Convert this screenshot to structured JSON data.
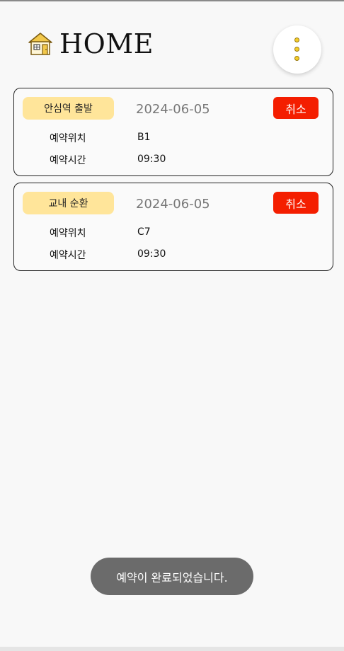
{
  "header": {
    "title": "HOME",
    "home_icon": "house-icon",
    "menu_icon": "more-vertical-icon"
  },
  "reservations": [
    {
      "route": "안심역 출발",
      "date": "2024-06-05",
      "cancel_label": "취소",
      "location_label": "예약위치",
      "location": "B1",
      "time_label": "예약시간",
      "time": "09:30"
    },
    {
      "route": "교내 순환",
      "date": "2024-06-05",
      "cancel_label": "취소",
      "location_label": "예약위치",
      "location": "C7",
      "time_label": "예약시간",
      "time": "09:30"
    }
  ],
  "toast": {
    "message": "예약이 완료되었습니다."
  },
  "colors": {
    "background": "#f8f8f8",
    "route_badge": "#ffe59a",
    "cancel_button": "#f41e00",
    "toast_background": "#6b6b6b",
    "menu_dots": "#f4cd2a"
  }
}
